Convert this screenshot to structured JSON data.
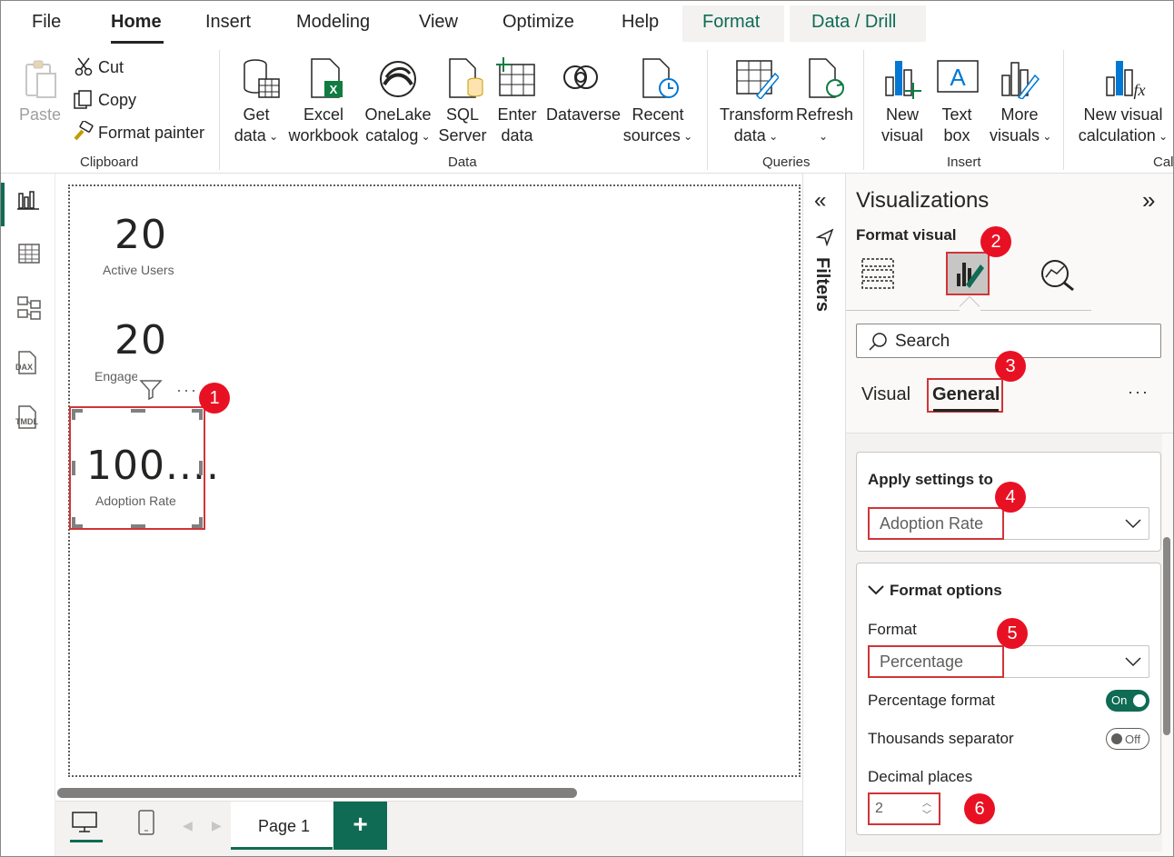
{
  "menu": {
    "tabs": [
      "File",
      "Home",
      "Insert",
      "Modeling",
      "View",
      "Optimize",
      "Help",
      "Format",
      "Data / Drill"
    ],
    "active": "Home"
  },
  "ribbon": {
    "clipboard": {
      "paste": "Paste",
      "cut": "Cut",
      "copy": "Copy",
      "format_painter": "Format painter",
      "group": "Clipboard"
    },
    "data": {
      "get_data": [
        "Get",
        "data"
      ],
      "excel": [
        "Excel",
        "workbook"
      ],
      "onelake": [
        "OneLake",
        "catalog"
      ],
      "sql": [
        "SQL",
        "Server"
      ],
      "enter": [
        "Enter",
        "data"
      ],
      "dataverse": "Dataverse",
      "recent": [
        "Recent",
        "sources"
      ],
      "group": "Data"
    },
    "queries": {
      "transform": [
        "Transform",
        "data"
      ],
      "refresh": "Refresh",
      "group": "Queries"
    },
    "insert": {
      "new_visual": [
        "New",
        "visual"
      ],
      "text_box": [
        "Text",
        "box"
      ],
      "more": [
        "More",
        "visuals"
      ],
      "group": "Insert"
    },
    "calc": {
      "new_calc": [
        "New visual",
        "calculation"
      ],
      "group": "Calc"
    }
  },
  "rail": {
    "icons": [
      "report-view-icon",
      "table-view-icon",
      "model-view-icon",
      "dax-query-icon",
      "tmdl-view-icon"
    ],
    "dax": "DAX",
    "tmdl": "TMDL"
  },
  "cards": [
    {
      "value": "20",
      "label": "Active Users"
    },
    {
      "value": "20",
      "label": "Engage"
    },
    {
      "value": "100....",
      "label": "Adoption Rate"
    }
  ],
  "filters": {
    "label": "Filters"
  },
  "viz": {
    "title": "Visualizations",
    "format_visual": "Format visual",
    "search_placeholder": "Search",
    "tabs": {
      "visual": "Visual",
      "general": "General"
    },
    "apply_settings": {
      "title": "Apply settings to",
      "value": "Adoption Rate"
    },
    "format_options": {
      "title": "Format options",
      "format_label": "Format",
      "format_value": "Percentage",
      "pct_format": "Percentage format",
      "pct_toggle": "On",
      "thousands": "Thousands separator",
      "thousands_toggle": "Off",
      "decimal_label": "Decimal places",
      "decimal_value": "2"
    }
  },
  "bottom": {
    "page": "Page 1",
    "add": "+"
  },
  "badges": [
    "1",
    "2",
    "3",
    "4",
    "5",
    "6"
  ],
  "colors": {
    "accent": "#0f6b54",
    "badge": "#e81123",
    "highlight": "#d13438"
  }
}
